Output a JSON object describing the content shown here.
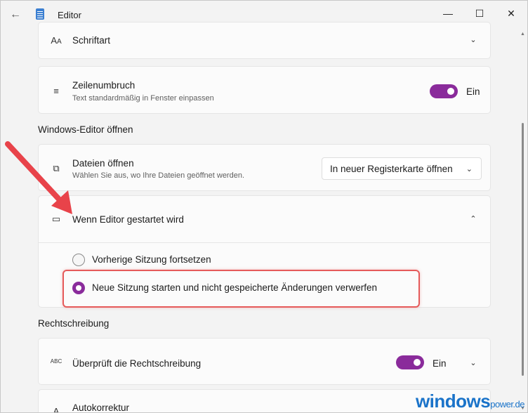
{
  "window": {
    "title": "Editor"
  },
  "font_row": {
    "label": "Schriftart"
  },
  "wrap_row": {
    "label": "Zeilenumbruch",
    "sublabel": "Text standardmäßig in Fenster einpassen",
    "toggle_label": "Ein"
  },
  "section_open": {
    "label": "Windows-Editor öffnen"
  },
  "files_row": {
    "label": "Dateien öffnen",
    "sublabel": "Wählen Sie aus, wo Ihre Dateien geöffnet werden.",
    "dropdown_value": "In neuer Registerkarte öffnen"
  },
  "startup_row": {
    "label": "Wenn Editor gestartet wird",
    "options": [
      {
        "label": "Vorherige Sitzung fortsetzen",
        "selected": false
      },
      {
        "label": "Neue Sitzung starten und nicht gespeicherte Änderungen verwerfen",
        "selected": true
      }
    ]
  },
  "section_spell": {
    "label": "Rechtschreibung"
  },
  "spell_row": {
    "label": "Überprüft die Rechtschreibung",
    "toggle_label": "Ein",
    "icon_text": "ABC"
  },
  "autocorrect_row": {
    "label": "Autokorrektur"
  },
  "watermark": {
    "main": "windows",
    "suffix": "power.de"
  },
  "colors": {
    "accent": "#8a2b9b",
    "highlight": "#e55a5a",
    "arrow": "#e8434a"
  }
}
